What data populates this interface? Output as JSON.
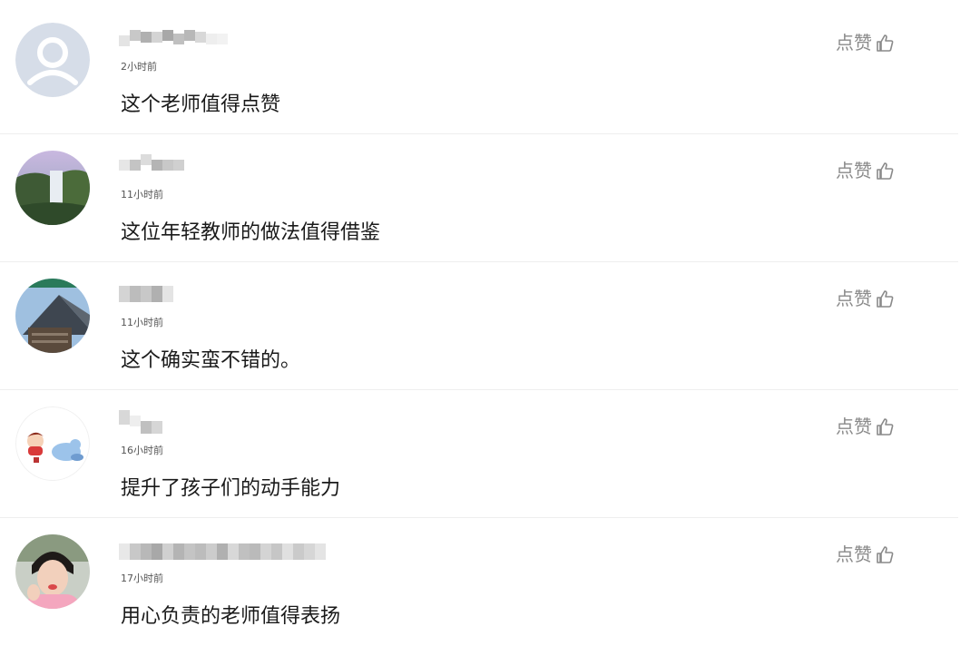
{
  "comments": [
    {
      "time": "2小时前",
      "content": "这个老师值得点赞",
      "like_label": "点赞",
      "like_icon": "thumbs-up-outline-icon",
      "avatar": "default-user-avatar",
      "username_blurred": true
    },
    {
      "time": "11小时前",
      "content": "这位年轻教师的做法值得借鉴",
      "like_label": "点赞",
      "like_icon": "thumbs-up-outline-icon",
      "avatar": "waterfall-photo-avatar",
      "username_blurred": true
    },
    {
      "time": "11小时前",
      "content": "这个确实蛮不错的。",
      "like_label": "点赞",
      "like_icon": "thumbs-up-outline-icon",
      "avatar": "pyramid-building-avatar",
      "username_blurred": true
    },
    {
      "time": "16小时前",
      "content": "提升了孩子们的动手能力",
      "like_label": "点赞",
      "like_icon": "thumbs-up-outline-icon",
      "avatar": "cartoon-baby-avatar",
      "username_blurred": true
    },
    {
      "time": "17小时前",
      "content": "用心负责的老师值得表扬",
      "like_label": "点赞",
      "like_icon": "thumbs-up-outline-icon",
      "avatar": "person-selfie-avatar",
      "username_blurred": true
    }
  ],
  "colors": {
    "like_text": "#8a8a8a",
    "time_text": "#555555",
    "content_text": "#1a1a1a",
    "divider": "#eeeeee"
  }
}
